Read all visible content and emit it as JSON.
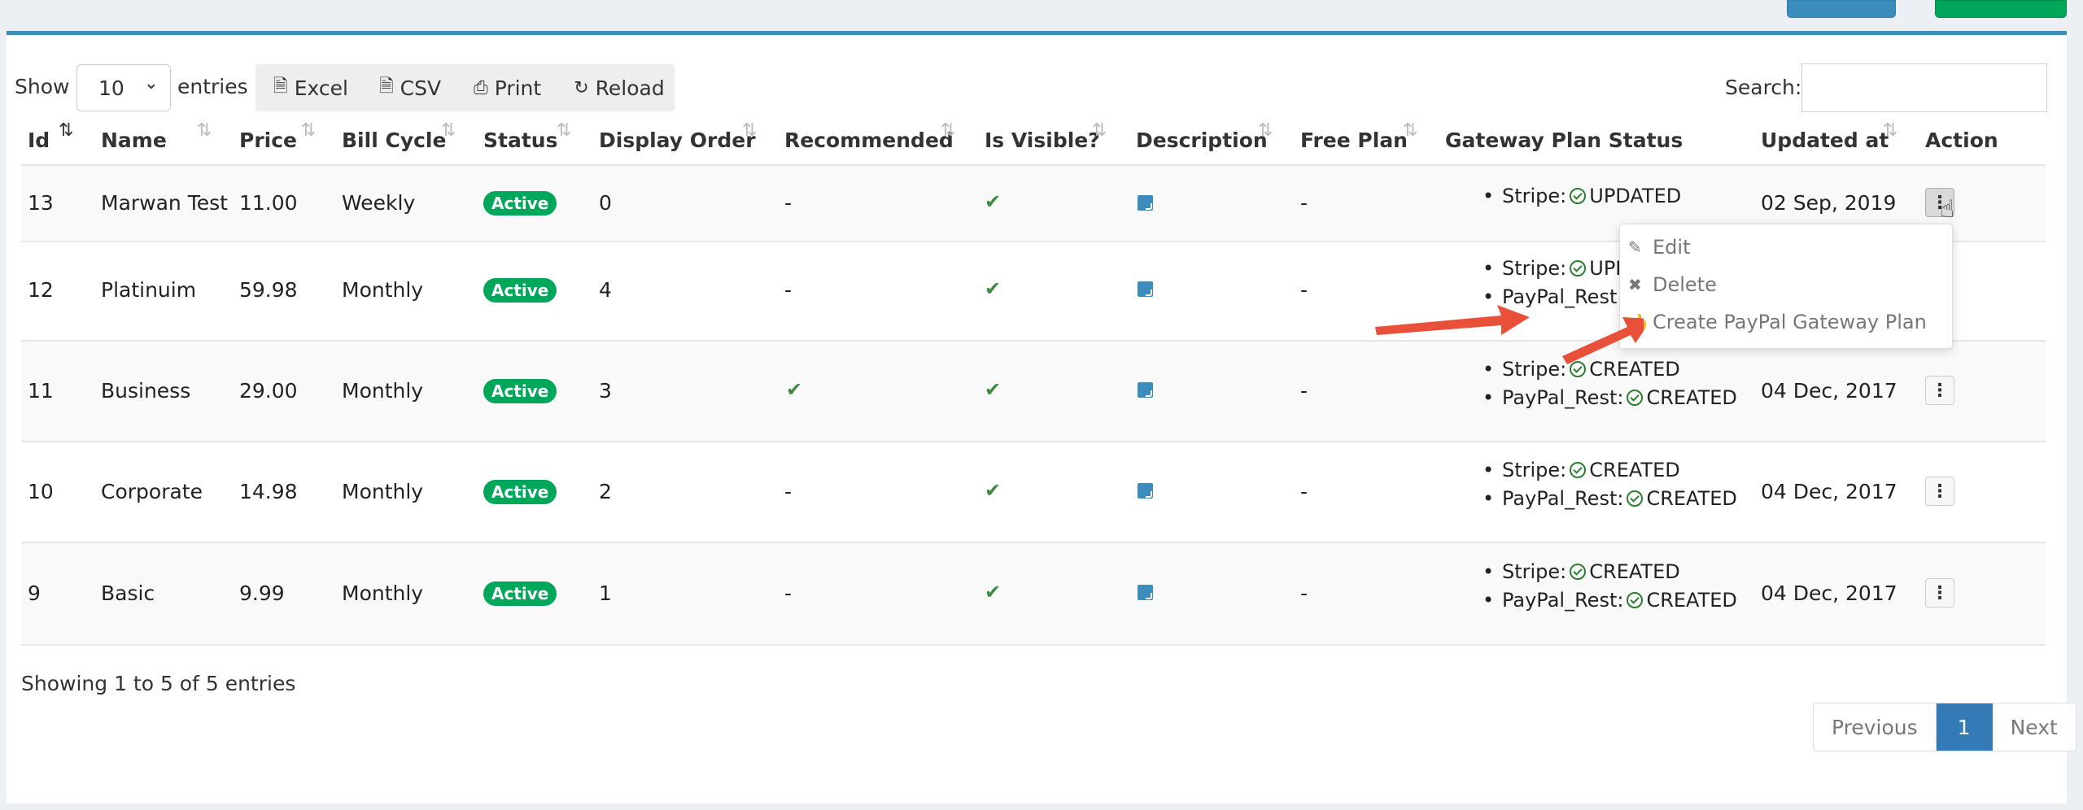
{
  "toolbar": {
    "show_label": "Show",
    "page_length": "10",
    "entries_label": "entries",
    "buttons": [
      {
        "label": "Excel",
        "icon": "file-excel-icon"
      },
      {
        "label": "CSV",
        "icon": "file-csv-icon"
      },
      {
        "label": "Print",
        "icon": "print-icon"
      },
      {
        "label": "Reload",
        "icon": "refresh-icon"
      }
    ],
    "search_label": "Search:",
    "search_value": ""
  },
  "table": {
    "columns": [
      "Id",
      "Name",
      "Price",
      "Bill Cycle",
      "Status",
      "Display Order",
      "Recommended",
      "Is Visible?",
      "Description",
      "Free Plan",
      "Gateway Plan Status",
      "Updated at",
      "Action"
    ],
    "rows": [
      {
        "id": "13",
        "name": "Marwan Test",
        "price": "11.00",
        "bill_cycle": "Weekly",
        "status": "Active",
        "display_order": "0",
        "recommended": "-",
        "is_visible": true,
        "free_plan": "-",
        "gateway": [
          {
            "label": "Stripe:",
            "status": "UPDATED"
          }
        ],
        "updated_at": "02 Sep, 2019"
      },
      {
        "id": "12",
        "name": "Platinuim",
        "price": "59.98",
        "bill_cycle": "Monthly",
        "status": "Active",
        "display_order": "4",
        "recommended": "-",
        "is_visible": true,
        "free_plan": "-",
        "gateway": [
          {
            "label": "Stripe:",
            "status": "UPD"
          },
          {
            "label": "PayPal_Rest:",
            "status": ""
          }
        ],
        "updated_at": ""
      },
      {
        "id": "11",
        "name": "Business",
        "price": "29.00",
        "bill_cycle": "Monthly",
        "status": "Active",
        "display_order": "3",
        "recommended": "check",
        "is_visible": true,
        "free_plan": "-",
        "gateway": [
          {
            "label": "Stripe:",
            "status": "CREATED"
          },
          {
            "label": "PayPal_Rest:",
            "status": "CREATED"
          }
        ],
        "updated_at": "04 Dec, 2017"
      },
      {
        "id": "10",
        "name": "Corporate",
        "price": "14.98",
        "bill_cycle": "Monthly",
        "status": "Active",
        "display_order": "2",
        "recommended": "-",
        "is_visible": true,
        "free_plan": "-",
        "gateway": [
          {
            "label": "Stripe:",
            "status": "CREATED"
          },
          {
            "label": "PayPal_Rest:",
            "status": "CREATED"
          }
        ],
        "updated_at": "04 Dec, 2017"
      },
      {
        "id": "9",
        "name": "Basic",
        "price": "9.99",
        "bill_cycle": "Monthly",
        "status": "Active",
        "display_order": "1",
        "recommended": "-",
        "is_visible": true,
        "free_plan": "-",
        "gateway": [
          {
            "label": "Stripe:",
            "status": "CREATED"
          },
          {
            "label": "PayPal_Rest:",
            "status": "CREATED"
          }
        ],
        "updated_at": "04 Dec, 2017"
      }
    ]
  },
  "action_menu": {
    "items": [
      {
        "label": "Edit",
        "icon": "pencil-icon"
      },
      {
        "label": "Delete",
        "icon": "times-icon"
      },
      {
        "label": "Create PayPal Gateway Plan",
        "icon": "thumbs-up-icon"
      }
    ]
  },
  "footer": {
    "info": "Showing 1 to 5 of 5 entries",
    "pagination": {
      "previous": "Previous",
      "current": "1",
      "next": "Next"
    }
  },
  "colors": {
    "primary": "#3c8dbc",
    "success": "#00a65a",
    "annotation_arrow": "#e8503a"
  }
}
